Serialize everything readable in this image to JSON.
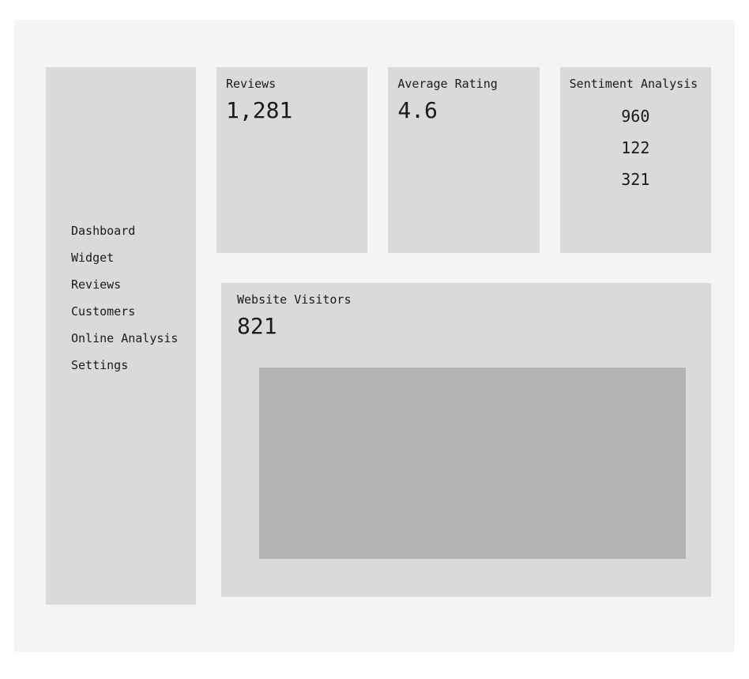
{
  "sidebar": {
    "items": [
      {
        "label": "Dashboard"
      },
      {
        "label": "Widget"
      },
      {
        "label": "Reviews"
      },
      {
        "label": "Customers"
      },
      {
        "label": "Online Analysis"
      },
      {
        "label": "Settings"
      }
    ]
  },
  "cards": {
    "reviews": {
      "title": "Reviews",
      "value": "1,281"
    },
    "rating": {
      "title": "Average Rating",
      "value": "4.6"
    },
    "sentiment": {
      "title": "Sentiment Analysis",
      "values": [
        "960",
        "122",
        "321"
      ]
    }
  },
  "visitors": {
    "title": "Website Visitors",
    "value": "821"
  }
}
